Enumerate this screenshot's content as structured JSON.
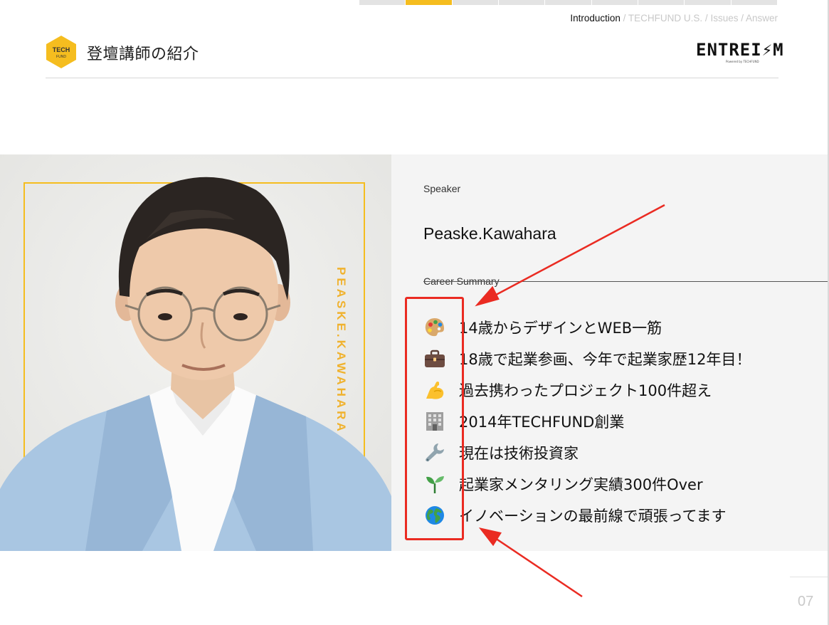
{
  "progress": {
    "segments": 9,
    "active_index": 1
  },
  "breadcrumb": {
    "current": "Introduction",
    "separator": " / ",
    "items": [
      "TECHFUND U.S.",
      "Issues",
      "Answer"
    ]
  },
  "header": {
    "badge_line1": "TECH",
    "badge_line2": "FUND",
    "title": "登壇講師の紹介",
    "logo_text": "ENTREI⚡M",
    "logo_sub": "Powered by TECHFUND"
  },
  "photo": {
    "vertical_name": "PEASKE.KAWAHARA",
    "frame_color": "#f5bd1f"
  },
  "speaker": {
    "label": "Speaker",
    "name": "Peaske.Kawahara"
  },
  "career": {
    "label": "Career Summary",
    "items": [
      {
        "icon": "palette-icon",
        "text": "14歳からデザインとWEB一筋"
      },
      {
        "icon": "briefcase-icon",
        "text": "18歳で起業参画、今年で起業家歴12年目！"
      },
      {
        "icon": "flexed-biceps-icon",
        "text": "過去携わったプロジェクト100件超え"
      },
      {
        "icon": "office-building-icon",
        "text": "2014年TECHFUND創業"
      },
      {
        "icon": "wrench-icon",
        "text": "現在は技術投資家"
      },
      {
        "icon": "seedling-icon",
        "text": "起業家メンタリング実績300件Over"
      },
      {
        "icon": "globe-icon",
        "text": "イノベーションの最前線で頑張ってます"
      }
    ]
  },
  "annotation_color": "#ea2b22",
  "accent_color": "#f5bd1f",
  "page_number": "07"
}
